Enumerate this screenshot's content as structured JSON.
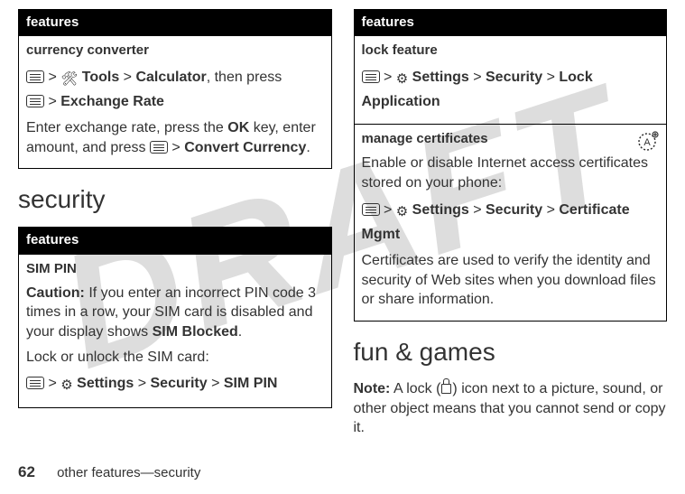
{
  "watermark": "DRAFT",
  "left": {
    "table1_header": "features",
    "table1_title": "currency converter",
    "table1_path1_a": "Tools",
    "table1_path1_b": "Calculator",
    "table1_path1_tail": ", then press",
    "table1_path2": "Exchange Rate",
    "table1_body1": "Enter exchange rate, press the ",
    "table1_ok": "OK",
    "table1_body2": " key, enter amount, and press ",
    "table1_convert": "Convert Currency",
    "section_security": "security",
    "table2_header": "features",
    "table2_title": "SIM PIN",
    "table2_caution_label": "Caution:",
    "table2_caution_body": " If you enter an incorrect PIN code 3 times in a row, your SIM card is disabled and your display shows ",
    "table2_simblocked": "SIM Blocked",
    "table2_lockline": "Lock or unlock the SIM card:",
    "table2_path_settings": "Settings",
    "table2_path_security": "Security",
    "table2_path_simpin": "SIM PIN"
  },
  "right": {
    "table_header": "features",
    "r1_title": "lock feature",
    "r1_settings": "Settings",
    "r1_security": "Security",
    "r1_lockapp": "Lock Application",
    "r2_title": "manage certificates",
    "r2_body1": "Enable or disable Internet access certificates stored on your phone:",
    "r2_settings": "Settings",
    "r2_security": "Security",
    "r2_certmgmt": "Certificate Mgmt",
    "r2_body2": "Certificates are used to verify the identity and security of Web sites when you download files or share information.",
    "section_fun": "fun & games",
    "note_label": "Note:",
    "note_body1": " A lock (",
    "note_body2": ") icon next to a picture, sound, or other object means that you cannot send or copy it."
  },
  "footer": {
    "page": "62",
    "text": "other features—security"
  }
}
